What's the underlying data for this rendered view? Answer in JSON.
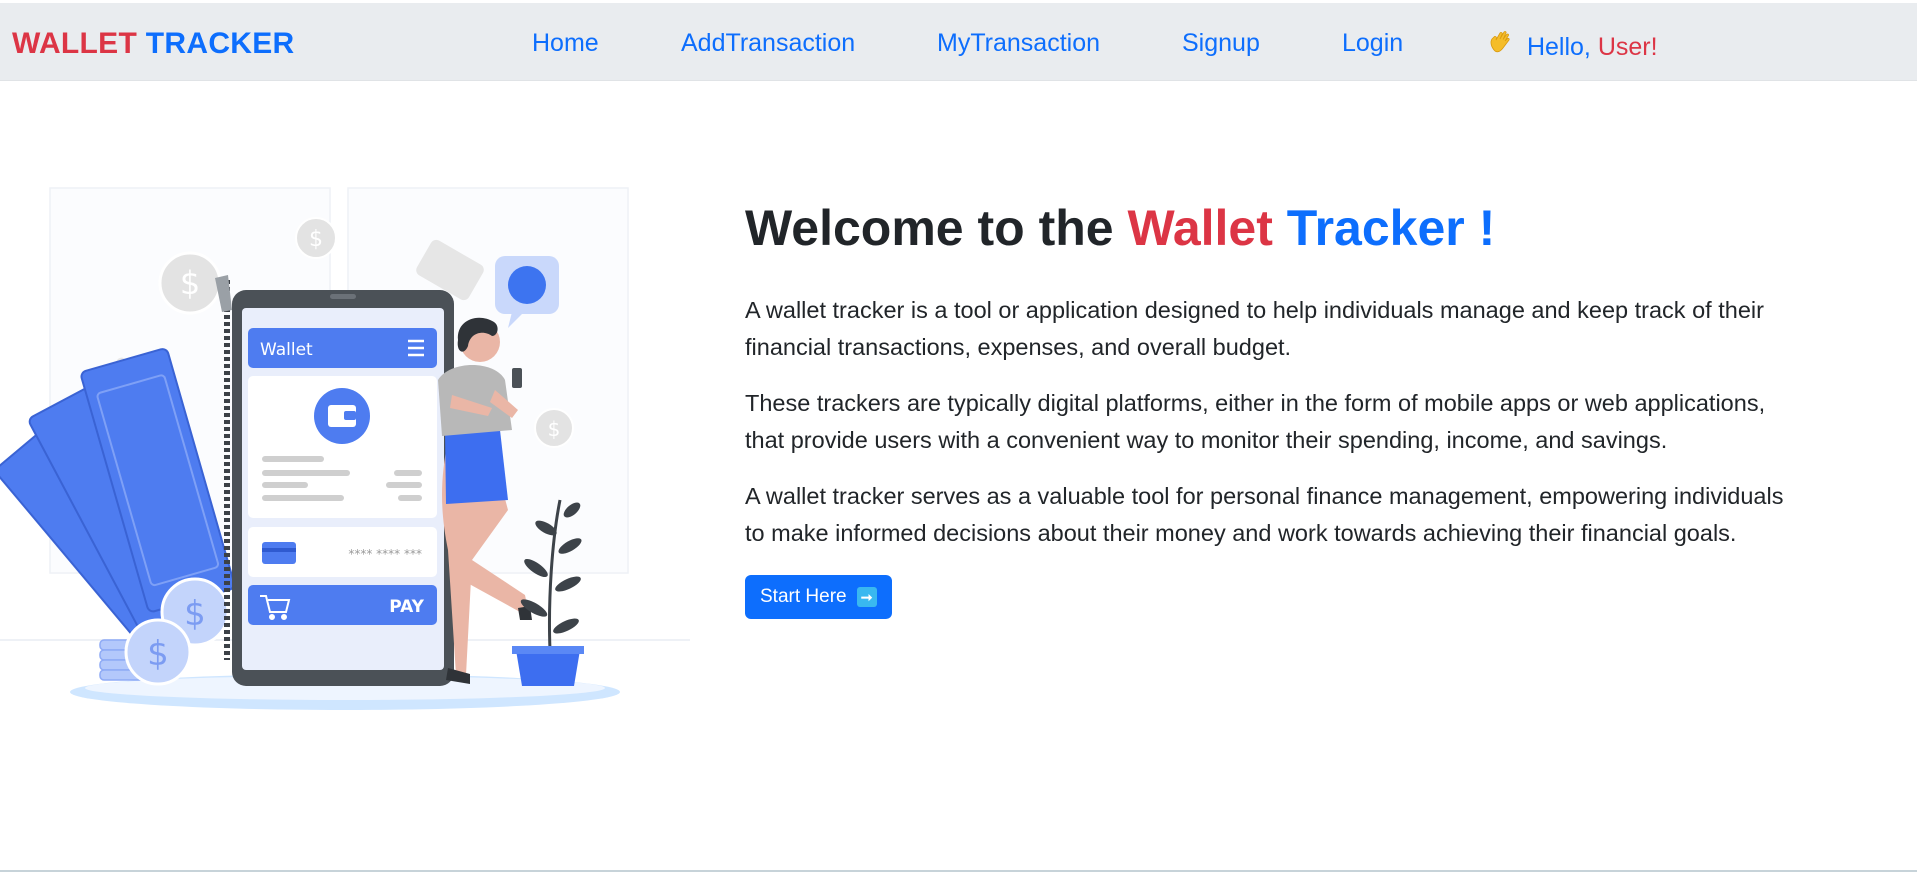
{
  "navbar": {
    "brand_part1": "WALLET",
    "brand_part2": "TRACKER",
    "links": [
      {
        "label": "Home"
      },
      {
        "label": "AddTransaction"
      },
      {
        "label": "MyTransaction"
      },
      {
        "label": "Signup"
      },
      {
        "label": "Login"
      }
    ],
    "greeting_icon": "waving-hand-icon",
    "greeting_hello": "Hello,",
    "greeting_user": "User!"
  },
  "hero": {
    "headline_prefix": "Welcome to the",
    "headline_red": "Wallet",
    "headline_blue": "Tracker !",
    "paragraphs": [
      "A wallet tracker is a tool or application designed to help individuals manage and keep track of their financial transactions, expenses, and overall budget.",
      "These trackers are typically digital platforms, either in the form of mobile apps or web applications, that provide users with a convenient way to monitor their spending, income, and savings.",
      "A wallet tracker serves as a valuable tool for personal finance management, empowering individuals to make informed decisions about their money and work towards achieving their financial goals."
    ],
    "start_button_label": "Start Here",
    "start_button_icon": "arrow-right-icon"
  },
  "illustration": {
    "phone_header": "Wallet",
    "card_mask": "**** **** ***",
    "pay_label": "PAY"
  },
  "colors": {
    "brand_red": "#dc3545",
    "brand_blue": "#0d6efd",
    "navbar_bg": "#e9ecef",
    "illustration_blue": "#4e7cf0"
  }
}
